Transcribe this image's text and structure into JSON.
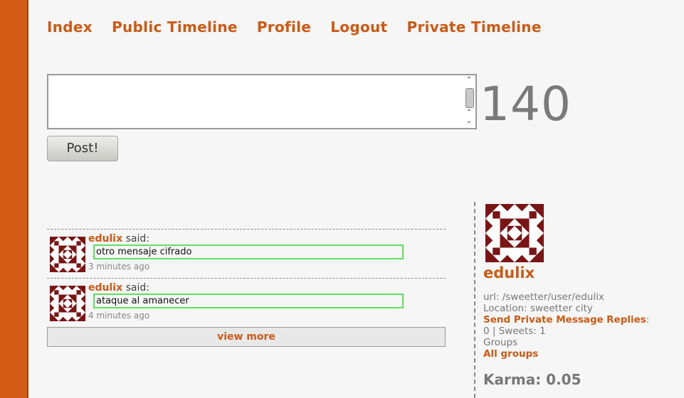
{
  "nav": {
    "index": "Index",
    "public_timeline": "Public Timeline",
    "profile": "Profile",
    "logout": "Logout",
    "private_timeline": "Private Timeline"
  },
  "composer": {
    "value": "",
    "char_counter": "140",
    "post_label": "Post!"
  },
  "timeline": {
    "entries": [
      {
        "user": "edulix",
        "said": "said:",
        "message": "otro mensaje cifrado",
        "time": "3 minutes ago"
      },
      {
        "user": "edulix",
        "said": "said:",
        "message": "ataque al amanecer",
        "time": "4 minutes ago"
      }
    ],
    "view_more": "view more"
  },
  "sidebar": {
    "username": "edulix",
    "url": "url: /sweetter/user/edulix",
    "location": "Location: sweetter city",
    "send_private": "Send Private Message",
    "replies": "Replies",
    "colon": ":",
    "counts": "0 | Sweets: 1",
    "groups": "Groups",
    "all_groups": "All groups",
    "karma": "Karma: 0.05"
  },
  "colors": {
    "accent": "#cc5a14",
    "background": "#d35a14",
    "avatar": "#7a1515"
  }
}
